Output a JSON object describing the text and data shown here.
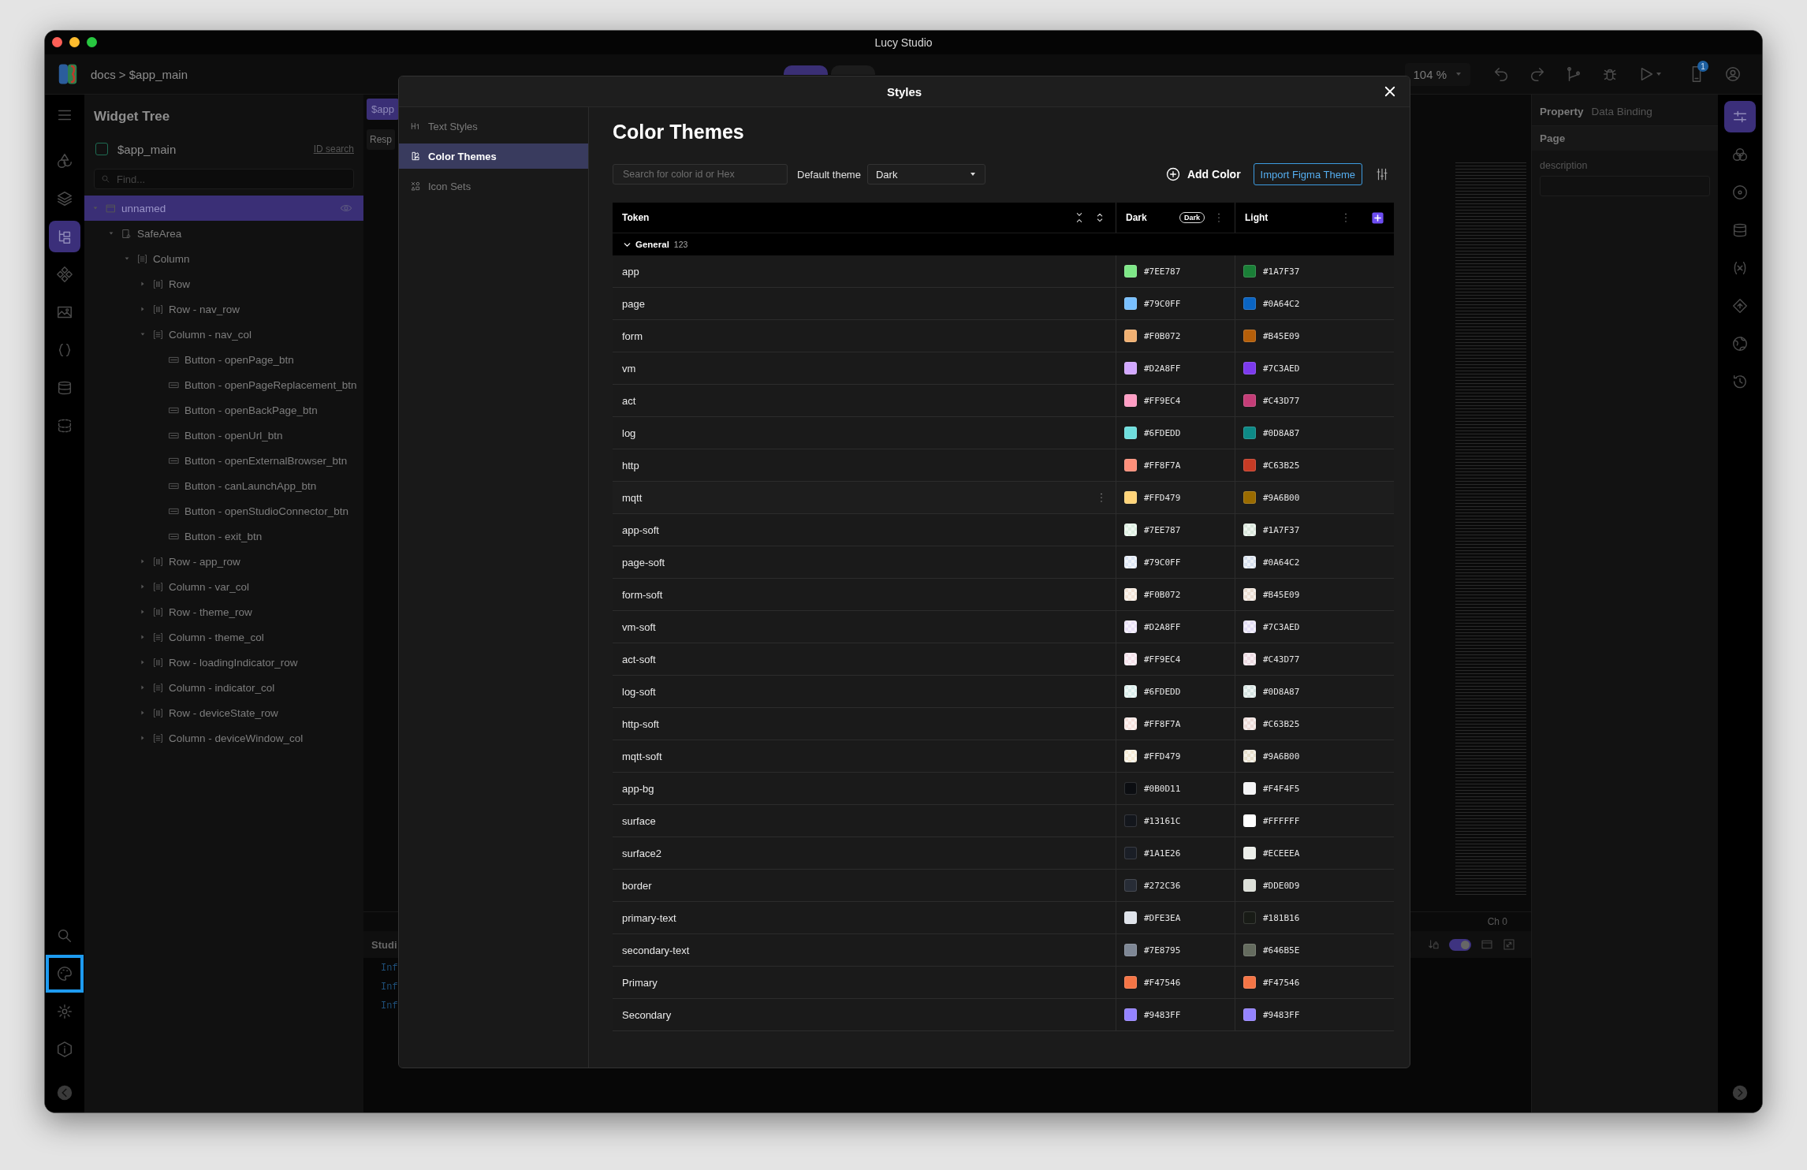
{
  "window": {
    "title": "Lucy Studio"
  },
  "toolbar": {
    "breadcrumb": "docs > $app_main",
    "mode_tabs": [
      {
        "selected": true
      },
      {
        "selected": false
      }
    ],
    "zoom": "104 %",
    "notification_badge": "1"
  },
  "left_rail": {
    "items": [
      {
        "kind": "menu",
        "selected": false
      },
      {
        "kind": "shapes",
        "selected": false
      },
      {
        "kind": "layers",
        "selected": false
      },
      {
        "kind": "tree",
        "selected": true
      },
      {
        "kind": "component",
        "selected": false
      },
      {
        "kind": "image",
        "selected": false
      },
      {
        "kind": "braces",
        "selected": false
      },
      {
        "kind": "database",
        "selected": false
      },
      {
        "kind": "dashed-database",
        "selected": false
      }
    ],
    "bottom_items": [
      {
        "kind": "search",
        "focused": false
      },
      {
        "kind": "palette",
        "focused": true
      },
      {
        "kind": "gear",
        "focused": false
      },
      {
        "kind": "info",
        "focused": false
      }
    ]
  },
  "widget_tree": {
    "title": "Widget Tree",
    "root_label": "$app_main",
    "root_checked": false,
    "id_search": "ID search",
    "search_placeholder": "Find...",
    "nodes": [
      {
        "label": "unnamed",
        "kind": "screen",
        "expanded": true,
        "selected": true,
        "children": [
          {
            "label": "SafeArea",
            "kind": "safearea",
            "expanded": true,
            "selected": false,
            "children": [
              {
                "label": "Column",
                "kind": "column",
                "expanded": true,
                "selected": false,
                "children": [
                  {
                    "label": "Row",
                    "kind": "row",
                    "expanded": false,
                    "selected": false
                  },
                  {
                    "label": "Row - nav_row",
                    "kind": "row",
                    "expanded": false,
                    "selected": false
                  },
                  {
                    "label": "Column - nav_col",
                    "kind": "column",
                    "expanded": true,
                    "selected": false,
                    "children": [
                      {
                        "label": "Button - openPage_btn",
                        "kind": "button",
                        "selected": false
                      },
                      {
                        "label": "Button - openPageReplacement_btn",
                        "kind": "button",
                        "selected": false
                      },
                      {
                        "label": "Button - openBackPage_btn",
                        "kind": "button",
                        "selected": false
                      },
                      {
                        "label": "Button - openUrl_btn",
                        "kind": "button",
                        "selected": false
                      },
                      {
                        "label": "Button - openExternalBrowser_btn",
                        "kind": "button",
                        "selected": false
                      },
                      {
                        "label": "Button - canLaunchApp_btn",
                        "kind": "button",
                        "selected": false
                      },
                      {
                        "label": "Button - openStudioConnector_btn",
                        "kind": "button",
                        "selected": false
                      },
                      {
                        "label": "Button - exit_btn",
                        "kind": "button",
                        "selected": false
                      }
                    ]
                  },
                  {
                    "label": "Row - app_row",
                    "kind": "row",
                    "expanded": false,
                    "selected": false
                  },
                  {
                    "label": "Column - var_col",
                    "kind": "column",
                    "expanded": false,
                    "selected": false
                  },
                  {
                    "label": "Row - theme_row",
                    "kind": "row",
                    "expanded": false,
                    "selected": false
                  },
                  {
                    "label": "Column - theme_col",
                    "kind": "column",
                    "expanded": false,
                    "selected": false
                  },
                  {
                    "label": "Row - loadingIndicator_row",
                    "kind": "row",
                    "expanded": false,
                    "selected": false
                  },
                  {
                    "label": "Column - indicator_col",
                    "kind": "column",
                    "expanded": false,
                    "selected": false
                  },
                  {
                    "label": "Row - deviceState_row",
                    "kind": "row",
                    "expanded": false,
                    "selected": false
                  },
                  {
                    "label": "Column - deviceWindow_col",
                    "kind": "column",
                    "expanded": false,
                    "selected": false
                  }
                ]
              }
            ]
          }
        ]
      }
    ]
  },
  "center": {
    "tab": "$app",
    "sub_tab": "Resp",
    "channel": "Ch 0",
    "console_title": "Studi",
    "console_lines": [
      "Inf",
      "Inf",
      "Inf"
    ],
    "autoscroll": {
      "on": true
    }
  },
  "right_panel": {
    "tabs": [
      {
        "label": "Property",
        "selected": true
      },
      {
        "label": "Data Binding",
        "selected": false
      }
    ],
    "section": "Page",
    "field_label": "description"
  },
  "right_rail": {
    "items": [
      {
        "kind": "sliders",
        "selected": true
      },
      {
        "kind": "circles",
        "selected": false
      },
      {
        "kind": "target",
        "selected": false
      },
      {
        "kind": "database",
        "selected": false
      },
      {
        "kind": "variable",
        "selected": false
      },
      {
        "kind": "tag",
        "selected": false
      },
      {
        "kind": "globe",
        "selected": false
      },
      {
        "kind": "history",
        "selected": false
      }
    ]
  },
  "modal": {
    "title": "Styles",
    "nav": [
      {
        "label": "Text Styles",
        "kind": "text",
        "selected": false
      },
      {
        "label": "Color Themes",
        "kind": "color",
        "selected": true
      },
      {
        "label": "Icon Sets",
        "kind": "icons",
        "selected": false
      }
    ],
    "heading": "Color Themes",
    "search_placeholder": "Search for color id or Hex",
    "default_theme_label": "Default theme",
    "default_theme_value": "Dark",
    "add_color": "Add Color",
    "import": "Import Figma Theme",
    "columns": [
      {
        "label": "Token"
      },
      {
        "label": "Dark",
        "badge": "Dark"
      },
      {
        "label": "Light"
      }
    ],
    "group": {
      "label": "General",
      "count": "123",
      "expanded": true
    },
    "rows": [
      {
        "token": "app",
        "kind": "solid",
        "hovered": false,
        "dark": {
          "hex": "#7EE787",
          "color": "#7ee787"
        },
        "light": {
          "hex": "#1A7F37",
          "color": "#1a7f37"
        }
      },
      {
        "token": "page",
        "kind": "solid",
        "hovered": false,
        "dark": {
          "hex": "#79C0FF",
          "color": "#79c0ff"
        },
        "light": {
          "hex": "#0A64C2",
          "color": "#0a64c2"
        }
      },
      {
        "token": "form",
        "kind": "solid",
        "hovered": false,
        "dark": {
          "hex": "#F0B072",
          "color": "#f0b072"
        },
        "light": {
          "hex": "#B45E09",
          "color": "#b45e09"
        }
      },
      {
        "token": "vm",
        "kind": "solid",
        "hovered": false,
        "dark": {
          "hex": "#D2A8FF",
          "color": "#d2a8ff"
        },
        "light": {
          "hex": "#7C3AED",
          "color": "#7c3aed"
        }
      },
      {
        "token": "act",
        "kind": "solid",
        "hovered": false,
        "dark": {
          "hex": "#FF9EC4",
          "color": "#ff9ec4"
        },
        "light": {
          "hex": "#C43D77",
          "color": "#c43d77"
        }
      },
      {
        "token": "log",
        "kind": "solid",
        "hovered": false,
        "dark": {
          "hex": "#6FDEDD",
          "color": "#6fdedd"
        },
        "light": {
          "hex": "#0D8A87",
          "color": "#0d8a87"
        }
      },
      {
        "token": "http",
        "kind": "solid",
        "hovered": false,
        "dark": {
          "hex": "#FF8F7A",
          "color": "#ff8f7a"
        },
        "light": {
          "hex": "#C63B25",
          "color": "#c63b25"
        }
      },
      {
        "token": "mqtt",
        "kind": "solid",
        "hovered": true,
        "dark": {
          "hex": "#FFD479",
          "color": "#ffd479"
        },
        "light": {
          "hex": "#9A6B00",
          "color": "#9a6b00"
        }
      },
      {
        "token": "app-soft",
        "kind": "soft",
        "hovered": false,
        "dark": {
          "hex": "#7EE787",
          "color": "#dcefe0"
        },
        "light": {
          "hex": "#1A7F37",
          "color": "#d8e6da"
        }
      },
      {
        "token": "page-soft",
        "kind": "soft",
        "hovered": false,
        "dark": {
          "hex": "#79C0FF",
          "color": "#dde7f5"
        },
        "light": {
          "hex": "#0A64C2",
          "color": "#d6e0ee"
        }
      },
      {
        "token": "form-soft",
        "kind": "soft",
        "hovered": false,
        "dark": {
          "hex": "#F0B072",
          "color": "#f3e4d6"
        },
        "light": {
          "hex": "#B45E09",
          "color": "#eadcd0"
        }
      },
      {
        "token": "vm-soft",
        "kind": "soft",
        "hovered": false,
        "dark": {
          "hex": "#D2A8FF",
          "color": "#e9e0f7"
        },
        "light": {
          "hex": "#7C3AED",
          "color": "#e2dcf5"
        }
      },
      {
        "token": "act-soft",
        "kind": "soft",
        "hovered": false,
        "dark": {
          "hex": "#FF9EC4",
          "color": "#f5e1ea"
        },
        "light": {
          "hex": "#C43D77",
          "color": "#eddae2"
        }
      },
      {
        "token": "log-soft",
        "kind": "soft",
        "hovered": false,
        "dark": {
          "hex": "#6FDEDD",
          "color": "#d9eeec"
        },
        "light": {
          "hex": "#0D8A87",
          "color": "#d5e4e2"
        }
      },
      {
        "token": "http-soft",
        "kind": "soft",
        "hovered": false,
        "dark": {
          "hex": "#FF8F7A",
          "color": "#f5e0dc"
        },
        "light": {
          "hex": "#C63B25",
          "color": "#ecdad6"
        }
      },
      {
        "token": "mqtt-soft",
        "kind": "soft",
        "hovered": false,
        "dark": {
          "hex": "#FFD479",
          "color": "#f4ead4"
        },
        "light": {
          "hex": "#9A6B00",
          "color": "#e8e0cc"
        }
      },
      {
        "token": "app-bg",
        "kind": "solid",
        "hovered": false,
        "dark": {
          "hex": "#0B0D11",
          "color": "#0b0d11"
        },
        "light": {
          "hex": "#F4F4F5",
          "color": "#f4f4f5"
        }
      },
      {
        "token": "surface",
        "kind": "solid",
        "hovered": false,
        "dark": {
          "hex": "#13161C",
          "color": "#13161c"
        },
        "light": {
          "hex": "#FFFFFF",
          "color": "#ffffff"
        }
      },
      {
        "token": "surface2",
        "kind": "solid",
        "hovered": false,
        "dark": {
          "hex": "#1A1E26",
          "color": "#1a1e26"
        },
        "light": {
          "hex": "#ECEEEA",
          "color": "#eceeea"
        }
      },
      {
        "token": "border",
        "kind": "solid",
        "hovered": false,
        "dark": {
          "hex": "#272C36",
          "color": "#272c36"
        },
        "light": {
          "hex": "#DDE0D9",
          "color": "#dde0d9"
        }
      },
      {
        "token": "primary-text",
        "kind": "solid",
        "hovered": false,
        "dark": {
          "hex": "#DFE3EA",
          "color": "#dfe3ea"
        },
        "light": {
          "hex": "#181B16",
          "color": "#181b16"
        }
      },
      {
        "token": "secondary-text",
        "kind": "solid",
        "hovered": false,
        "dark": {
          "hex": "#7E8795",
          "color": "#7e8795"
        },
        "light": {
          "hex": "#646B5E",
          "color": "#646b5e"
        }
      },
      {
        "token": "Primary",
        "kind": "solid",
        "hovered": false,
        "dark": {
          "hex": "#F47546",
          "color": "#f47546"
        },
        "light": {
          "hex": "#F47546",
          "color": "#f47546"
        }
      },
      {
        "token": "Secondary",
        "kind": "solid",
        "hovered": false,
        "dark": {
          "hex": "#9483FF",
          "color": "#9483ff"
        },
        "light": {
          "hex": "#9483FF",
          "color": "#9483ff"
        }
      }
    ]
  }
}
